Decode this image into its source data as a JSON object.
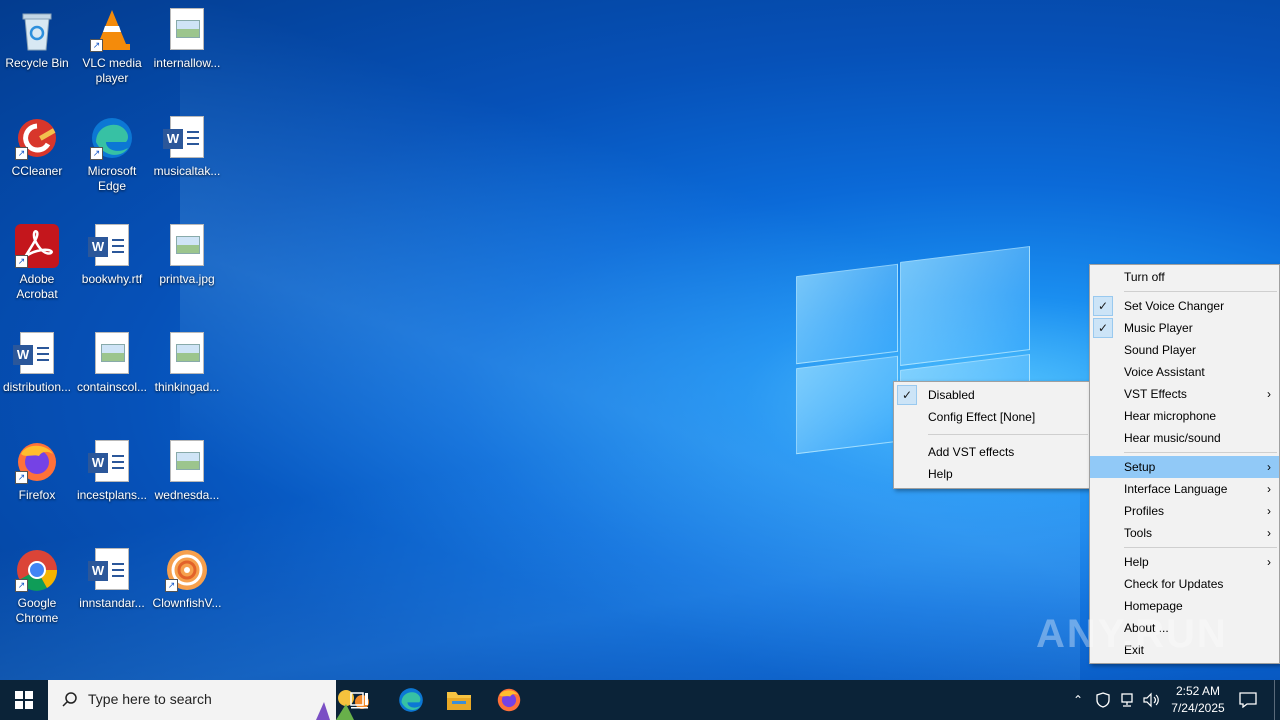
{
  "desktop": {
    "icons": [
      {
        "label": "Recycle Bin"
      },
      {
        "label": "VLC media player"
      },
      {
        "label": "internallow..."
      },
      {
        "label": "CCleaner"
      },
      {
        "label": "Microsoft Edge"
      },
      {
        "label": "musicaltak..."
      },
      {
        "label": "Adobe Acrobat"
      },
      {
        "label": "bookwhy.rtf"
      },
      {
        "label": "printva.jpg"
      },
      {
        "label": "distribution..."
      },
      {
        "label": "containscol..."
      },
      {
        "label": "thinkingad..."
      },
      {
        "label": "Firefox"
      },
      {
        "label": "incestplans..."
      },
      {
        "label": "wednesda..."
      },
      {
        "label": "Google Chrome"
      },
      {
        "label": "innstandar..."
      },
      {
        "label": "ClownfishV..."
      }
    ]
  },
  "main_menu": {
    "items": [
      {
        "label": "Turn off"
      },
      {
        "label": "Set Voice Changer",
        "checked": true
      },
      {
        "label": "Music Player",
        "checked": true
      },
      {
        "label": "Sound Player"
      },
      {
        "label": "Voice Assistant"
      },
      {
        "label": "VST Effects",
        "submenu": true
      },
      {
        "label": "Hear microphone"
      },
      {
        "label": "Hear music/sound"
      },
      {
        "label": "Setup",
        "submenu": true,
        "highlighted": true
      },
      {
        "label": "Interface Language",
        "submenu": true
      },
      {
        "label": "Profiles",
        "submenu": true
      },
      {
        "label": "Tools",
        "submenu": true
      },
      {
        "label": "Help",
        "submenu": true
      },
      {
        "label": "Check for Updates"
      },
      {
        "label": "Homepage"
      },
      {
        "label": "About ..."
      },
      {
        "label": "Exit"
      }
    ]
  },
  "sub_menu": {
    "items": [
      {
        "label": "Disabled",
        "checked": true
      },
      {
        "label": "Config Effect [None]"
      },
      {
        "label": "Add VST effects"
      },
      {
        "label": "Help"
      }
    ]
  },
  "taskbar": {
    "search_placeholder": "Type here to search",
    "time": "2:52 AM",
    "date": "7/24/2025"
  },
  "watermark": "ANY.RUN",
  "colors": {
    "accent": "#0078d7",
    "menu_highlight": "#91c9f7",
    "taskbar": "#0b2338"
  }
}
